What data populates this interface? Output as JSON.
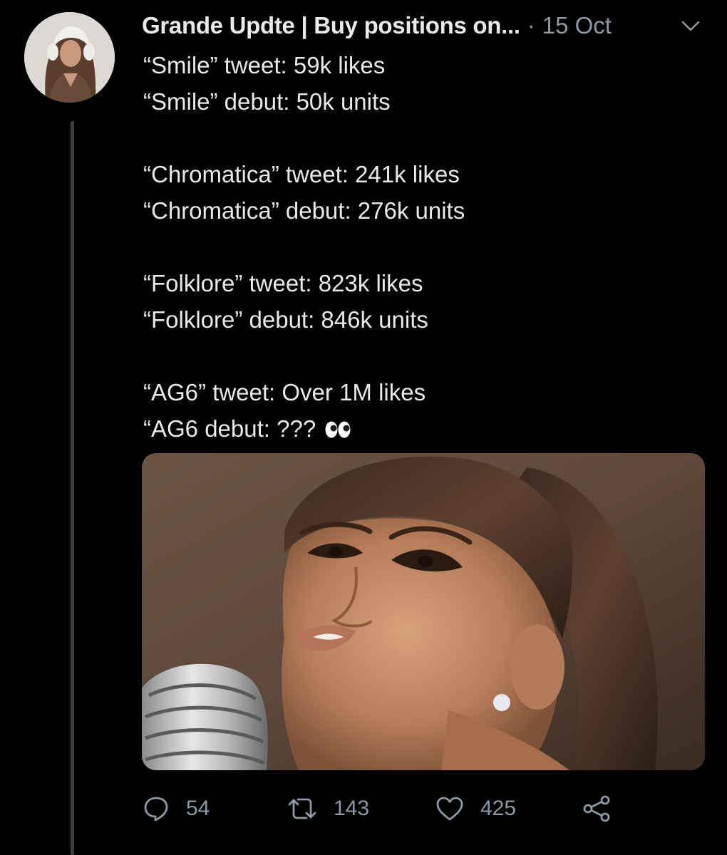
{
  "tweet": {
    "display_name": "Grande Updte | Buy positions on...",
    "separator": "·",
    "timestamp": "15 Oct",
    "lines": [
      "“Smile” tweet: 59k likes",
      "“Smile” debut: 50k units",
      "“Chromatica” tweet: 241k likes",
      "“Chromatica” debut: 276k units",
      "“Folklore” tweet: 823k likes",
      "“Folklore” debut: 846k units",
      "“AG6” tweet: Over 1M likes",
      "“AG6 debut: ???"
    ],
    "media": {
      "icon": "photo-singer-microphone"
    }
  },
  "actions": {
    "reply_count": "54",
    "retweet_count": "143",
    "like_count": "425"
  },
  "icons": {
    "reply": "reply-icon",
    "retweet": "retweet-icon",
    "like": "heart-icon",
    "share": "share-icon",
    "caret": "chevron-down-icon",
    "emoji": "eyes-emoji"
  },
  "colors": {
    "background": "#000000",
    "text": "#e7e9ea",
    "muted": "#8b98a5",
    "thread_line": "#3a3d41"
  }
}
